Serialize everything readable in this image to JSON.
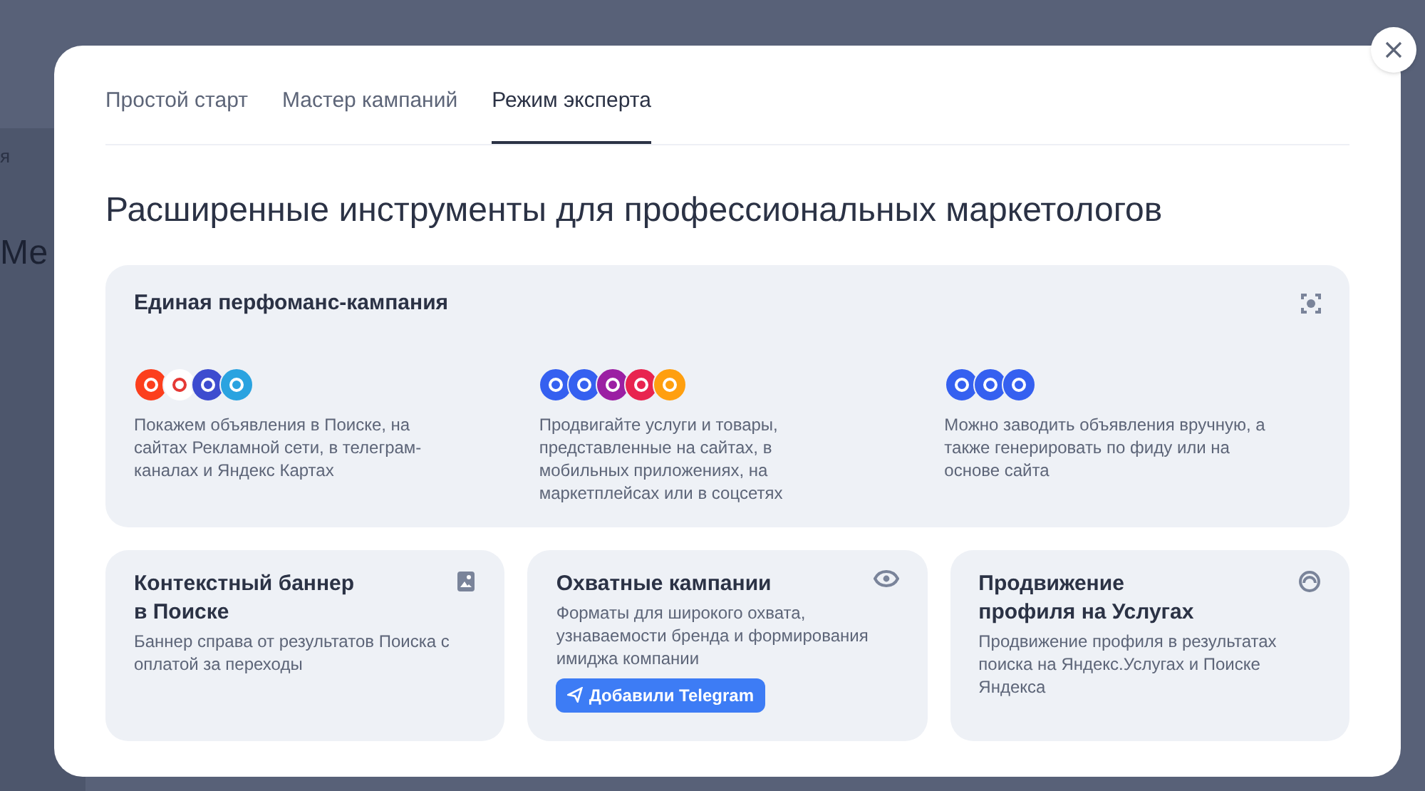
{
  "background": {
    "fragments": [
      "я",
      "Ме"
    ]
  },
  "tabs": [
    {
      "label": "Простой старт",
      "selected": false
    },
    {
      "label": "Мастер кампаний",
      "selected": false
    },
    {
      "label": "Режим эксперта",
      "selected": true
    }
  ],
  "heading": "Расширенные инструменты для профессиональных маркетологов",
  "main_card": {
    "title": "Единая перфоманс-кампания",
    "columns": [
      {
        "text": "Покажем объявления в Поиске, на сайтах Рекламной сети, в телеграм-каналах и Яндекс Картах"
      },
      {
        "text": "Продвигайте услуги и товары, представленные на сайтах, в мобильных приложениях, на маркетплейсах или в соцсетях"
      },
      {
        "text": "Можно заводить объявления вручную, а также генерировать по фиду или на основе сайта"
      }
    ]
  },
  "cards": [
    {
      "kind": "image",
      "title": "Контекстный баннер в Поиске",
      "text": "Баннер справа от результатов Поиска с оплатой за переходы"
    },
    {
      "kind": "eye",
      "title": "Охватные кампании",
      "text": "Форматы для широкого охвата, узнаваемости бренда и формирования имиджа компании",
      "button": "Добавили Telegram"
    },
    {
      "kind": "profile",
      "title": "Продвижение профиля на Услугах",
      "text": "Продвижение профиля в результатах поиска на Яндекс.Услугах и Поиске Яндекса"
    }
  ]
}
